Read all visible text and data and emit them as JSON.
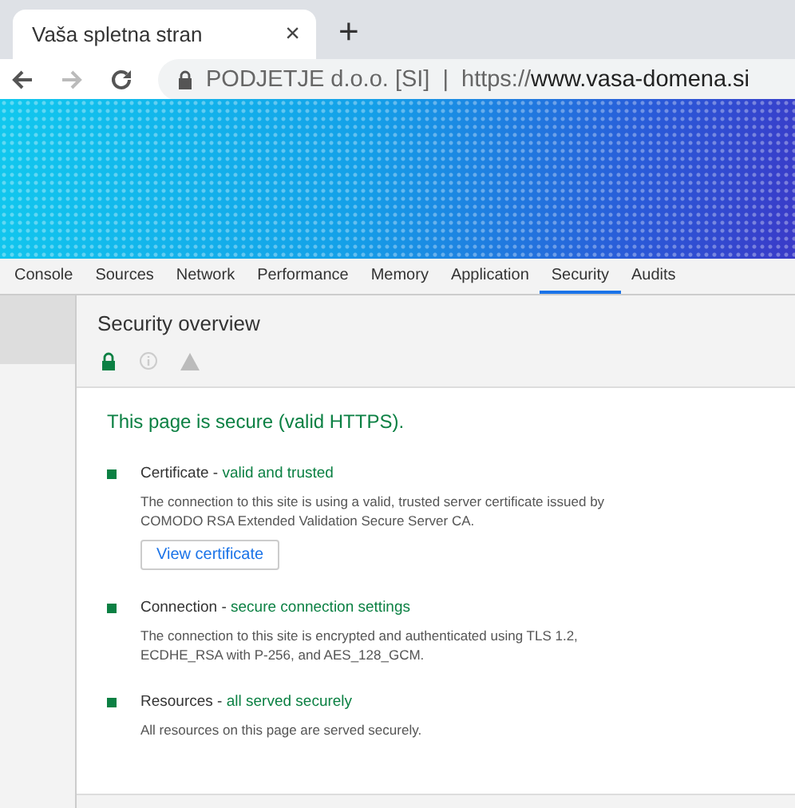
{
  "browser_tab": {
    "title": "Vaša spletna stran",
    "close": "×"
  },
  "new_tab": "+",
  "address_bar": {
    "org": "PODJETJE d.o.o. [SI]",
    "separator": "|",
    "scheme": "https://",
    "host": "www.vasa-domena.si"
  },
  "devtools_tabs": [
    {
      "label": "Console",
      "selected": false
    },
    {
      "label": "Sources",
      "selected": false
    },
    {
      "label": "Network",
      "selected": false
    },
    {
      "label": "Performance",
      "selected": false
    },
    {
      "label": "Memory",
      "selected": false
    },
    {
      "label": "Application",
      "selected": false
    },
    {
      "label": "Security",
      "selected": true
    },
    {
      "label": "Audits",
      "selected": false
    }
  ],
  "overview": {
    "title": "Security overview",
    "filters": [
      {
        "kind": "secure",
        "selected": true
      },
      {
        "kind": "info",
        "selected": false
      },
      {
        "kind": "warning",
        "selected": false
      }
    ]
  },
  "summary": "This page is secure (valid HTTPS).",
  "items": [
    {
      "title": "Certificate",
      "separator": "-",
      "status": "valid and trusted",
      "description": "The connection to this site is using a valid, trusted server certificate issued by COMODO RSA Extended Validation Secure Server CA.",
      "button": "View certificate",
      "color": "#0b8043"
    },
    {
      "title": "Connection",
      "separator": "-",
      "status": "secure connection settings",
      "description": "The connection to this site is encrypted and authenticated using TLS 1.2, ECDHE_RSA with P-256, and AES_128_GCM.",
      "color": "#0b8043"
    },
    {
      "title": "Resources",
      "separator": "-",
      "status": "all served securely",
      "description": "All resources on this page are served securely.",
      "color": "#0b8043"
    }
  ]
}
